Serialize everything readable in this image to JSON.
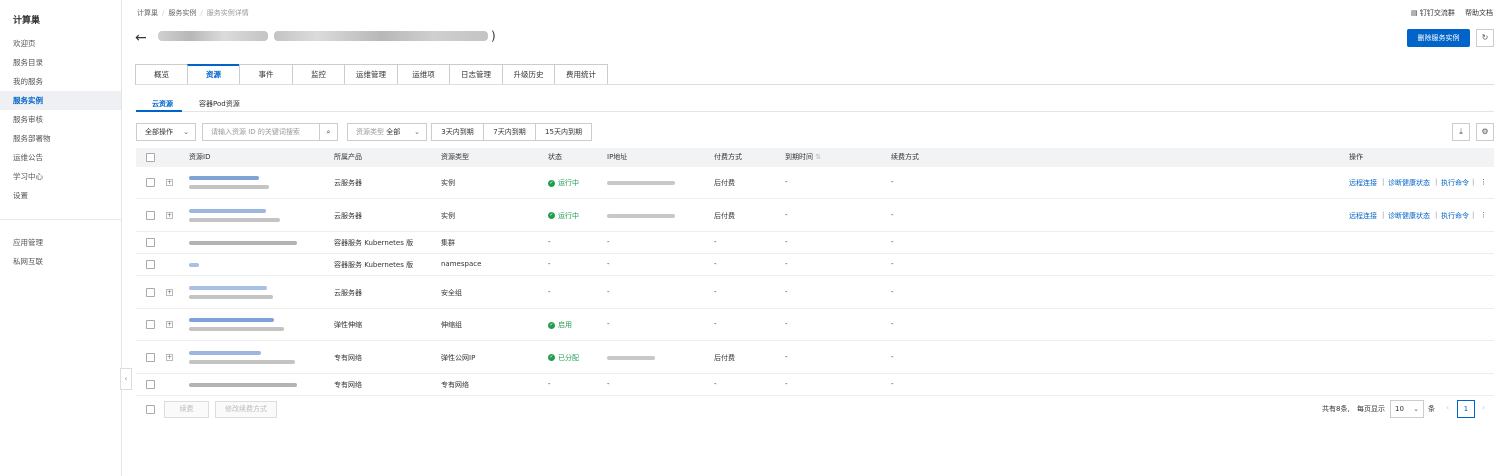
{
  "sidebar": {
    "title": "计算巢",
    "items": [
      "欢迎页",
      "服务目录",
      "我的服务",
      "服务实例",
      "服务审核",
      "服务部署物",
      "运维公告",
      "学习中心",
      "设置"
    ],
    "items2": [
      "应用管理",
      "私网互联"
    ],
    "active_index": 3
  },
  "breadcrumb": [
    "计算巢",
    "服务实例",
    "服务实例详情"
  ],
  "topbar": {
    "dingtalk": "钉钉交流群",
    "help": "帮助文档"
  },
  "header": {
    "back_icon": "arrow-left-icon",
    "title_suffix": ")",
    "delete_button": "删除服务实例",
    "refresh_icon": "refresh-icon"
  },
  "tabs": [
    "概览",
    "资源",
    "事件",
    "监控",
    "运维管理",
    "运维项",
    "日志管理",
    "升级历史",
    "费用统计"
  ],
  "active_tab": 1,
  "subtabs": [
    "云资源",
    "容器Pod资源"
  ],
  "toolbar": {
    "bulk_action": "全部操作",
    "search_placeholder": "请输入资源 ID 的关键词搜索",
    "resource_type_label": "资源类型",
    "resource_type_value": "全部",
    "expire_3": "3天内到期",
    "expire_7": "7天内到期",
    "expire_15": "15天内到期"
  },
  "table": {
    "headers": {
      "id": "资源ID",
      "product": "所属产品",
      "type": "资源类型",
      "status": "状态",
      "ip": "IP地址",
      "pay": "付费方式",
      "expire": "到期时间",
      "renew": "续费方式",
      "ops": "操作"
    },
    "rows": [
      {
        "product": "云服务器",
        "type": "实例",
        "status": "运行中",
        "status_ok": true,
        "ip_blur": true,
        "pay": "后付费",
        "expire": "-",
        "renew": "-",
        "ops": true,
        "expandable": true,
        "two_line": true
      },
      {
        "product": "云服务器",
        "type": "实例",
        "status": "运行中",
        "status_ok": true,
        "ip_blur": true,
        "pay": "后付费",
        "expire": "-",
        "renew": "-",
        "ops": true,
        "expandable": true,
        "two_line": true
      },
      {
        "product": "容器服务 Kubernetes 版",
        "type": "集群",
        "status": "-",
        "status_ok": false,
        "ip_blur": false,
        "pay": "-",
        "expire": "-",
        "renew": "-",
        "ops": false,
        "expandable": false,
        "two_line": false
      },
      {
        "product": "容器服务 Kubernetes 版",
        "type": "namespace",
        "status": "-",
        "status_ok": false,
        "ip_blur": false,
        "pay": "-",
        "expire": "-",
        "renew": "-",
        "ops": false,
        "expandable": false,
        "two_line": false
      },
      {
        "product": "云服务器",
        "type": "安全组",
        "status": "-",
        "status_ok": false,
        "ip_blur": false,
        "pay": "-",
        "expire": "-",
        "renew": "-",
        "ops": false,
        "expandable": true,
        "two_line": true
      },
      {
        "product": "弹性伸缩",
        "type": "伸缩组",
        "status": "启用",
        "status_ok": true,
        "ip_blur": false,
        "pay": "-",
        "expire": "-",
        "renew": "-",
        "ops": false,
        "expandable": true,
        "two_line": true
      },
      {
        "product": "专有网络",
        "type": "弹性公网IP",
        "status": "已分配",
        "status_ok": true,
        "ip_blur": true,
        "pay": "后付费",
        "expire": "-",
        "renew": "-",
        "ops": false,
        "expandable": true,
        "two_line": true
      },
      {
        "product": "专有网络",
        "type": "专有网络",
        "status": "-",
        "status_ok": false,
        "ip_blur": false,
        "pay": "-",
        "expire": "-",
        "renew": "-",
        "ops": false,
        "expandable": false,
        "two_line": false
      }
    ],
    "ops_labels": {
      "remote": "远程连接",
      "diagnose": "诊断健康状态",
      "exec": "执行命令",
      "more": "⋮"
    }
  },
  "footer": {
    "renew_button": "续费",
    "change_renew_button": "修改续费方式",
    "total": "共有8条,",
    "per_page_label": "每页显示",
    "per_page_value": "10",
    "per_page_unit": "条",
    "page": "1",
    "prev": "‹",
    "next": "›"
  },
  "colors": {
    "primary": "#0064c8",
    "success": "#1e9e4f"
  }
}
